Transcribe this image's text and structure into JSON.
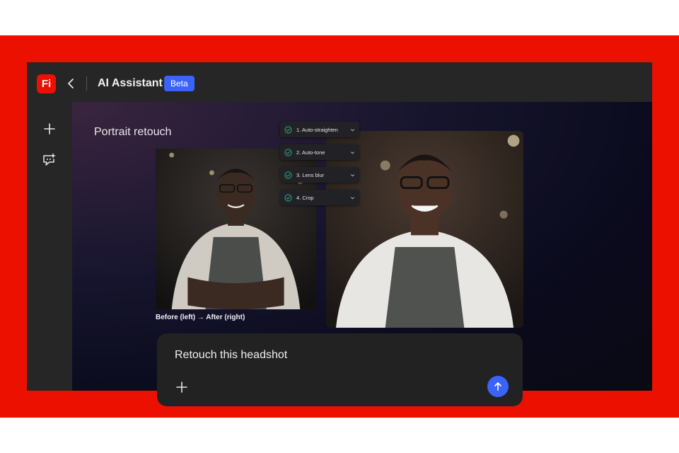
{
  "app": {
    "logo_text": "Fi",
    "title": "AI Assistant",
    "badge": "Beta",
    "brand_color": "#eb1000",
    "accent_color": "#3b63fb"
  },
  "toolbar": {
    "back_icon": "chevron-left-icon"
  },
  "sidebar": {
    "items": [
      {
        "icon": "plus-icon",
        "name": "new"
      },
      {
        "icon": "chat-sparkle-icon",
        "name": "assistant-chat"
      }
    ]
  },
  "canvas": {
    "title": "Portrait retouch",
    "caption": "Before (left) → After (right)"
  },
  "steps": [
    {
      "label": "1. Auto-straighten",
      "status": "done"
    },
    {
      "label": "2. Auto-tone",
      "status": "done"
    },
    {
      "label": "3. Lens blur",
      "status": "done"
    },
    {
      "label": "4. Crop",
      "status": "done"
    }
  ],
  "prompt": {
    "text": "Retouch this headshot",
    "attach_icon": "plus-icon",
    "send_icon": "arrow-up-icon"
  }
}
